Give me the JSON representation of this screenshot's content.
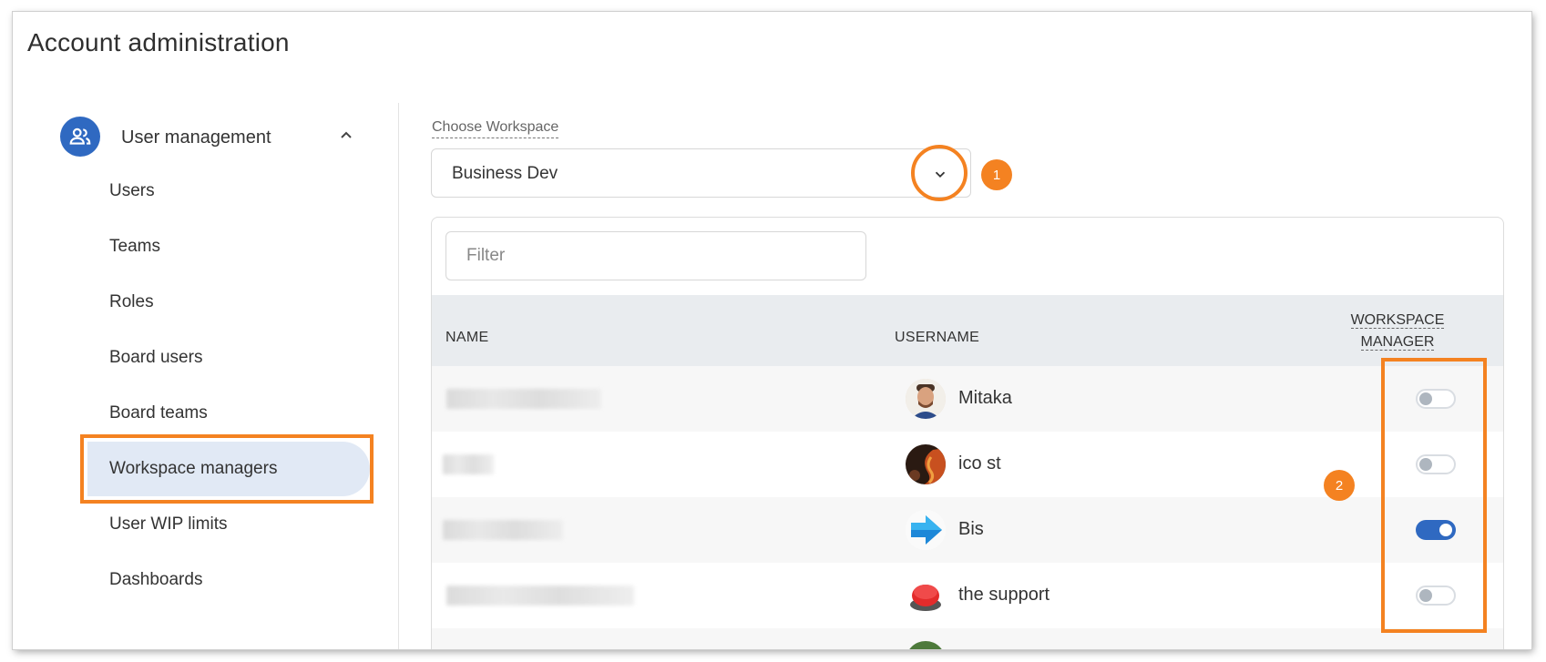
{
  "page": {
    "title": "Account administration"
  },
  "sidebar": {
    "section_label": "User management",
    "items": [
      {
        "label": "Users",
        "active": false
      },
      {
        "label": "Teams",
        "active": false
      },
      {
        "label": "Roles",
        "active": false
      },
      {
        "label": "Board users",
        "active": false
      },
      {
        "label": "Board teams",
        "active": false
      },
      {
        "label": "Workspace managers",
        "active": true
      },
      {
        "label": "User WIP limits",
        "active": false
      },
      {
        "label": "Dashboards",
        "active": false
      }
    ]
  },
  "workspace": {
    "label": "Choose Workspace",
    "selected": "Business Dev"
  },
  "filter": {
    "placeholder": "Filter",
    "value": ""
  },
  "table": {
    "headers": {
      "name": "NAME",
      "username": "USERNAME",
      "manager_line1": "WORKSPACE",
      "manager_line2": "MANAGER"
    },
    "rows": [
      {
        "username": "Mitaka",
        "workspace_manager": false,
        "avatar": "man-portrait-avatar"
      },
      {
        "username": "ico st",
        "workspace_manager": false,
        "avatar": "fire-avatar"
      },
      {
        "username": "Bis",
        "workspace_manager": true,
        "avatar": "blue-arrow-avatar"
      },
      {
        "username": "the support",
        "workspace_manager": false,
        "avatar": "help-button-avatar"
      }
    ]
  },
  "annotations": {
    "badge1": "1",
    "badge2": "2",
    "color": "#f48221"
  },
  "colors": {
    "accent": "#2f69c1",
    "highlight": "#f48221",
    "active_bg": "#e1e9f5"
  }
}
